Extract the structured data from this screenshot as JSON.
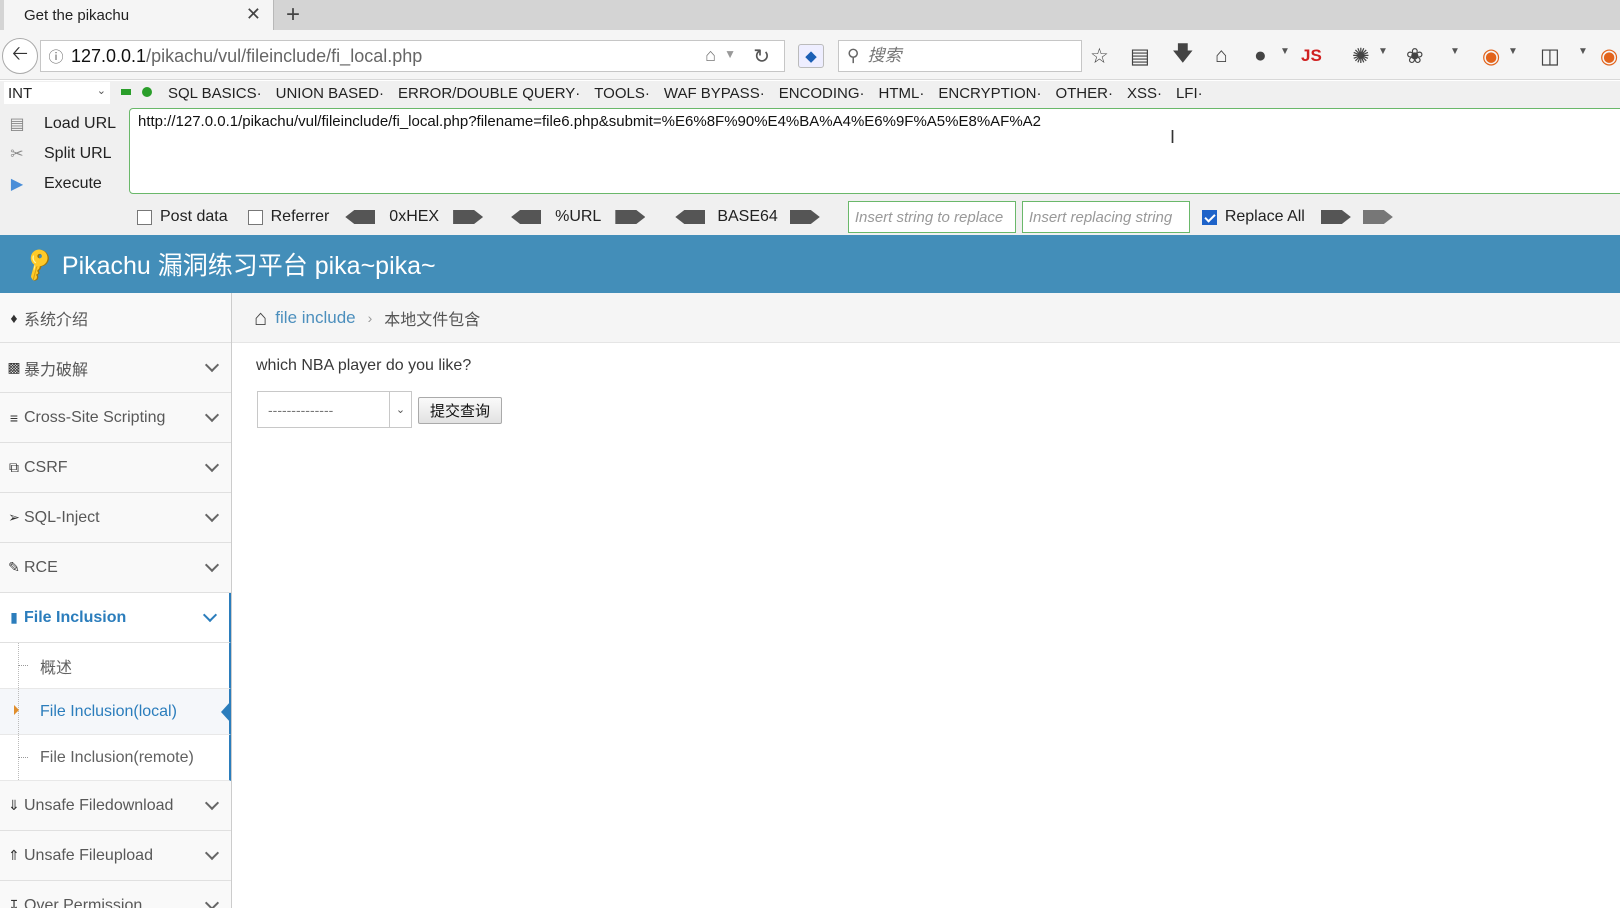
{
  "browser": {
    "tab_title": "Get the pikachu",
    "tab_close": "✕",
    "new_tab": "+",
    "url_host": "127.0.0.1",
    "url_path": "/pikachu/vul/fileinclude/fi_local.php",
    "search_placeholder": "搜索",
    "toolbar_js_label": "JS"
  },
  "hackbar": {
    "encoding_select": "INT",
    "menu": [
      "SQL BASICS·",
      "UNION BASED·",
      "ERROR/DOUBLE QUERY·",
      "TOOLS·",
      "WAF BYPASS·",
      "ENCODING·",
      "HTML·",
      "ENCRYPTION·",
      "OTHER·",
      "XSS·",
      "LFI·"
    ],
    "actions": {
      "load_url": "Load URL",
      "split_url": "Split URL",
      "execute": "Execute"
    },
    "url_value": "http://127.0.0.1/pikachu/vul/fileinclude/fi_local.php?filename=file6.php&submit=%E6%8F%90%E4%BA%A4%E6%9F%A5%E8%AF%A2",
    "post_data_label": "Post data",
    "referrer_label": "Referrer",
    "hex_label": "0xHEX",
    "url_label": "%URL",
    "base64_label": "BASE64",
    "replace_placeholder": "Insert string to replace",
    "replacing_placeholder": "Insert replacing string",
    "replace_all_label": "Replace All",
    "post_data_checked": false,
    "referrer_checked": false,
    "replace_all_checked": true
  },
  "site": {
    "title": "Pikachu 漏洞练习平台 pika~pika~"
  },
  "sidebar": {
    "items": [
      {
        "label": "系统介绍"
      },
      {
        "label": "暴力破解"
      },
      {
        "label": "Cross-Site Scripting"
      },
      {
        "label": "CSRF"
      },
      {
        "label": "SQL-Inject"
      },
      {
        "label": "RCE"
      },
      {
        "label": "File Inclusion"
      },
      {
        "label": "Unsafe Filedownload"
      },
      {
        "label": "Unsafe Fileupload"
      },
      {
        "label": "Over Permission"
      }
    ],
    "sub_items": [
      {
        "label": "概述"
      },
      {
        "label": "File Inclusion(local)"
      },
      {
        "label": "File Inclusion(remote)"
      }
    ]
  },
  "main": {
    "breadcrumb_link": "file include",
    "breadcrumb_current": "本地文件包含",
    "question": "which NBA player do you like?",
    "select_value": "--------------",
    "submit_label": "提交查询"
  },
  "colors": {
    "header_bg": "#438eb9",
    "active_blue": "#2b7dbc",
    "hackbar_green": "#6ab86a"
  }
}
